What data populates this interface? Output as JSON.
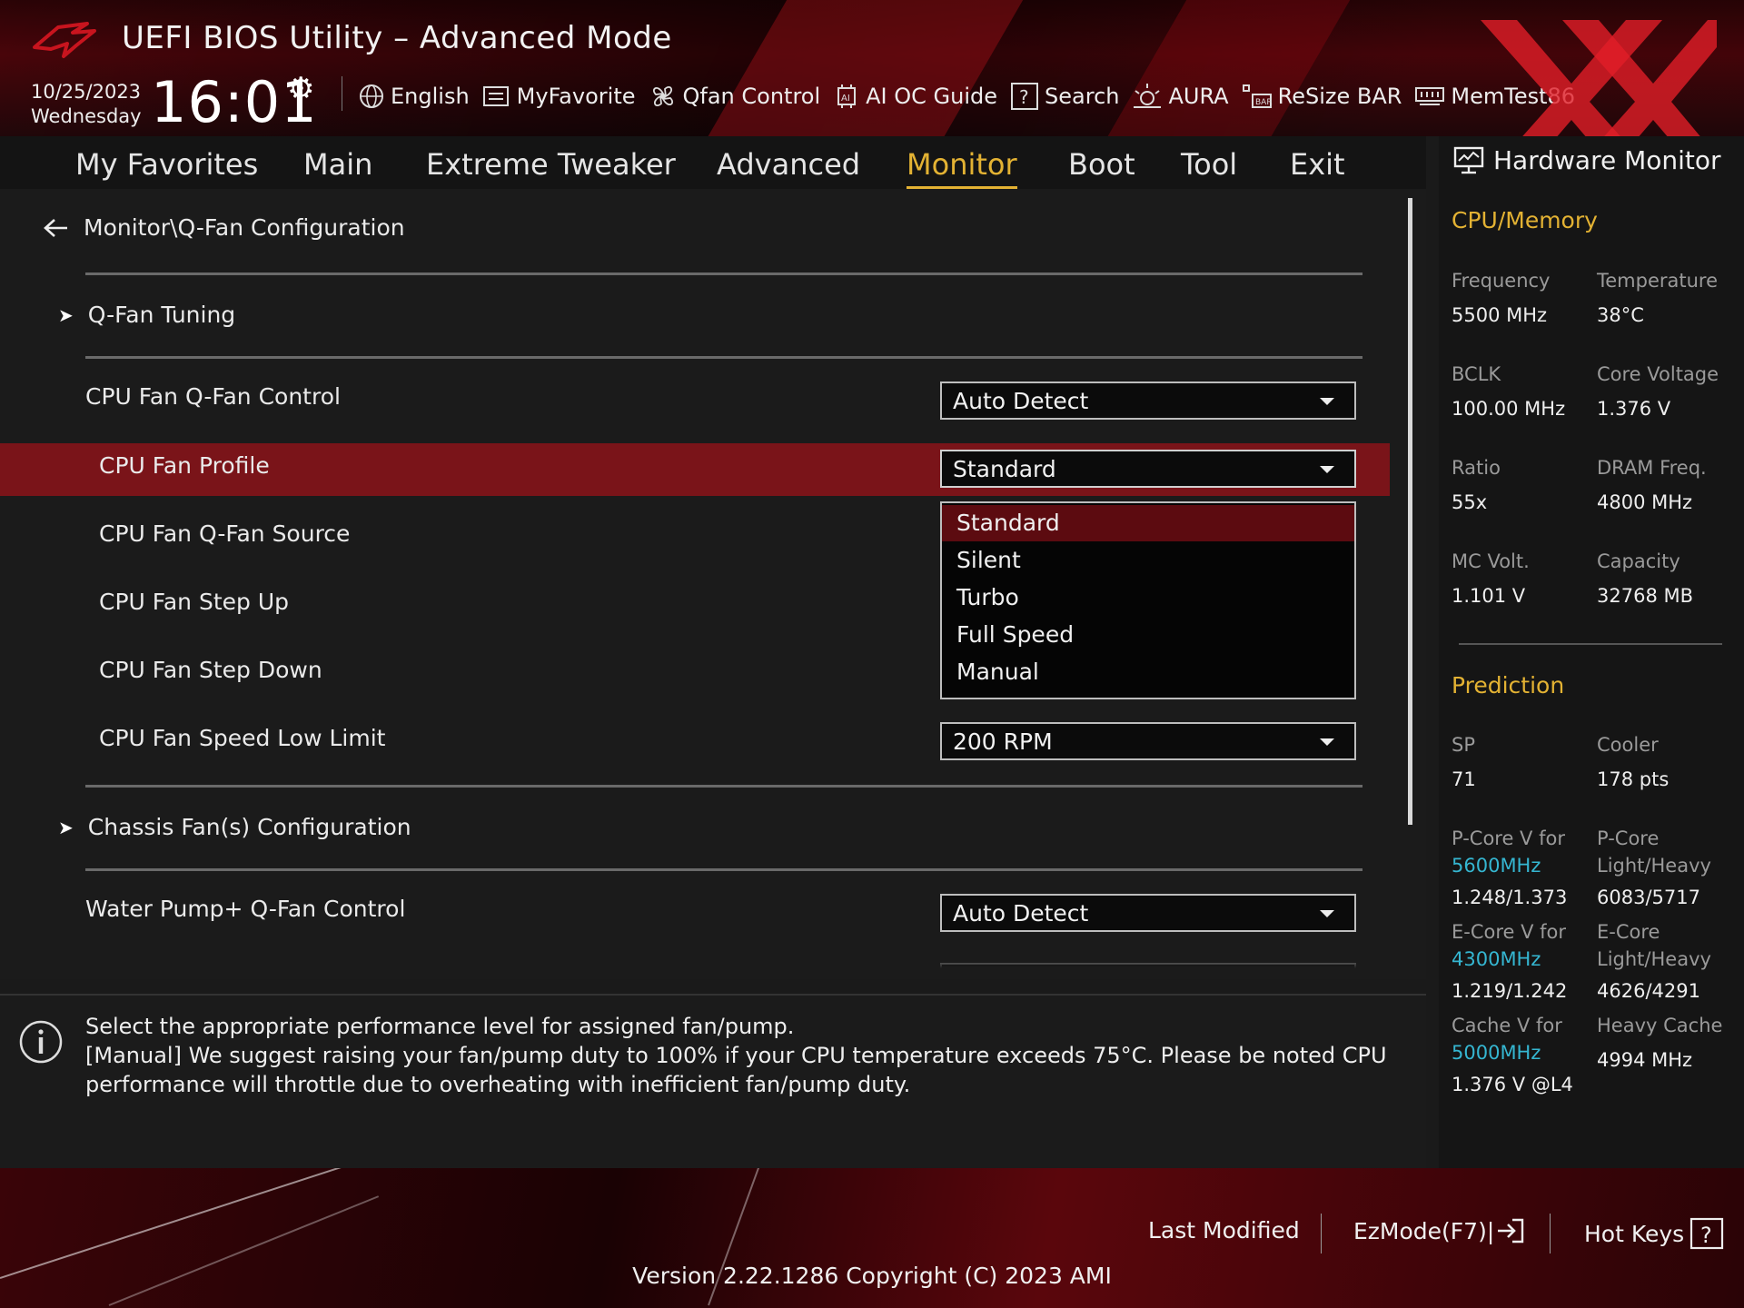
{
  "header": {
    "title": "UEFI BIOS Utility – Advanced Mode",
    "date": "10/25/2023",
    "weekday": "Wednesday",
    "time": "16:01",
    "tools": [
      {
        "label": "English",
        "icon": "globe-icon"
      },
      {
        "label": "MyFavorite",
        "icon": "favorite-icon"
      },
      {
        "label": "Qfan Control",
        "icon": "fan-icon"
      },
      {
        "label": "AI OC Guide",
        "icon": "ai-chip-icon"
      },
      {
        "label": "Search",
        "icon": "help-search-icon"
      },
      {
        "label": "AURA",
        "icon": "aura-icon"
      },
      {
        "label": "ReSize BAR",
        "icon": "resize-bar-icon"
      },
      {
        "label": "MemTest86",
        "icon": "memtest-icon"
      }
    ]
  },
  "nav": {
    "tabs": [
      "My Favorites",
      "Main",
      "Extreme Tweaker",
      "Advanced",
      "Monitor",
      "Boot",
      "Tool",
      "Exit"
    ],
    "active": "Monitor"
  },
  "main": {
    "breadcrumb": "Monitor\\Q-Fan Configuration",
    "qfan_tuning": "Q-Fan Tuning",
    "rows": {
      "cpu_fan_qfan_control": {
        "label": "CPU Fan Q-Fan Control",
        "value": "Auto Detect"
      },
      "cpu_fan_profile": {
        "label": "CPU Fan Profile",
        "value": "Standard"
      },
      "cpu_fan_qfan_source": {
        "label": "CPU Fan Q-Fan Source"
      },
      "cpu_fan_step_up": {
        "label": "CPU Fan Step Up"
      },
      "cpu_fan_step_down": {
        "label": "CPU Fan Step Down"
      },
      "cpu_fan_speed_low_limit": {
        "label": "CPU Fan Speed Low Limit",
        "value": "200 RPM"
      },
      "water_pump_qfan_control": {
        "label": "Water Pump+ Q-Fan Control",
        "value": "Auto Detect"
      }
    },
    "chassis_fans": "Chassis Fan(s) Configuration",
    "profile_options": [
      "Standard",
      "Silent",
      "Turbo",
      "Full Speed",
      "Manual"
    ],
    "profile_selected": "Standard"
  },
  "help": {
    "line1": "Select the appropriate performance level for assigned fan/pump.",
    "line2": "[Manual] We suggest raising your fan/pump duty to 100% if your CPU temperature exceeds 75°C. Please be noted CPU performance will throttle due to overheating with inefficient fan/pump duty."
  },
  "hardware_monitor": {
    "title": "Hardware Monitor",
    "cpu_memory": {
      "heading": "CPU/Memory",
      "frequency_label": "Frequency",
      "frequency": "5500 MHz",
      "temperature_label": "Temperature",
      "temperature": "38°C",
      "bclk_label": "BCLK",
      "bclk": "100.00 MHz",
      "core_voltage_label": "Core Voltage",
      "core_voltage": "1.376 V",
      "ratio_label": "Ratio",
      "ratio": "55x",
      "dram_freq_label": "DRAM Freq.",
      "dram_freq": "4800 MHz",
      "mc_volt_label": "MC Volt.",
      "mc_volt": "1.101 V",
      "capacity_label": "Capacity",
      "capacity": "32768 MB"
    },
    "prediction": {
      "heading": "Prediction",
      "sp_label": "SP",
      "sp": "71",
      "cooler_label": "Cooler",
      "cooler": "178 pts",
      "pcore_v_label": "P-Core V for",
      "pcore_v_freq": "5600MHz",
      "pcore_v": "1.248/1.373",
      "pcore_lh_label1": "P-Core",
      "pcore_lh_label2": "Light/Heavy",
      "pcore_lh": "6083/5717",
      "ecore_v_label": "E-Core V for",
      "ecore_v_freq": "4300MHz",
      "ecore_v": "1.219/1.242",
      "ecore_lh_label1": "E-Core",
      "ecore_lh_label2": "Light/Heavy",
      "ecore_lh": "4626/4291",
      "cache_v_label": "Cache V for",
      "cache_v_freq": "5000MHz",
      "cache_v": "1.376 V @L4",
      "heavy_cache_label": "Heavy Cache",
      "heavy_cache": "4994 MHz"
    }
  },
  "footer": {
    "last_modified": "Last Modified",
    "ezmode": "EzMode(F7)|",
    "hot_keys": "Hot Keys",
    "version": "Version 2.22.1286 Copyright (C) 2023 AMI"
  },
  "colors": {
    "accent_gold": "#e3b233",
    "highlight_red": "#7a1419",
    "info_cyan": "#35b6d1"
  }
}
